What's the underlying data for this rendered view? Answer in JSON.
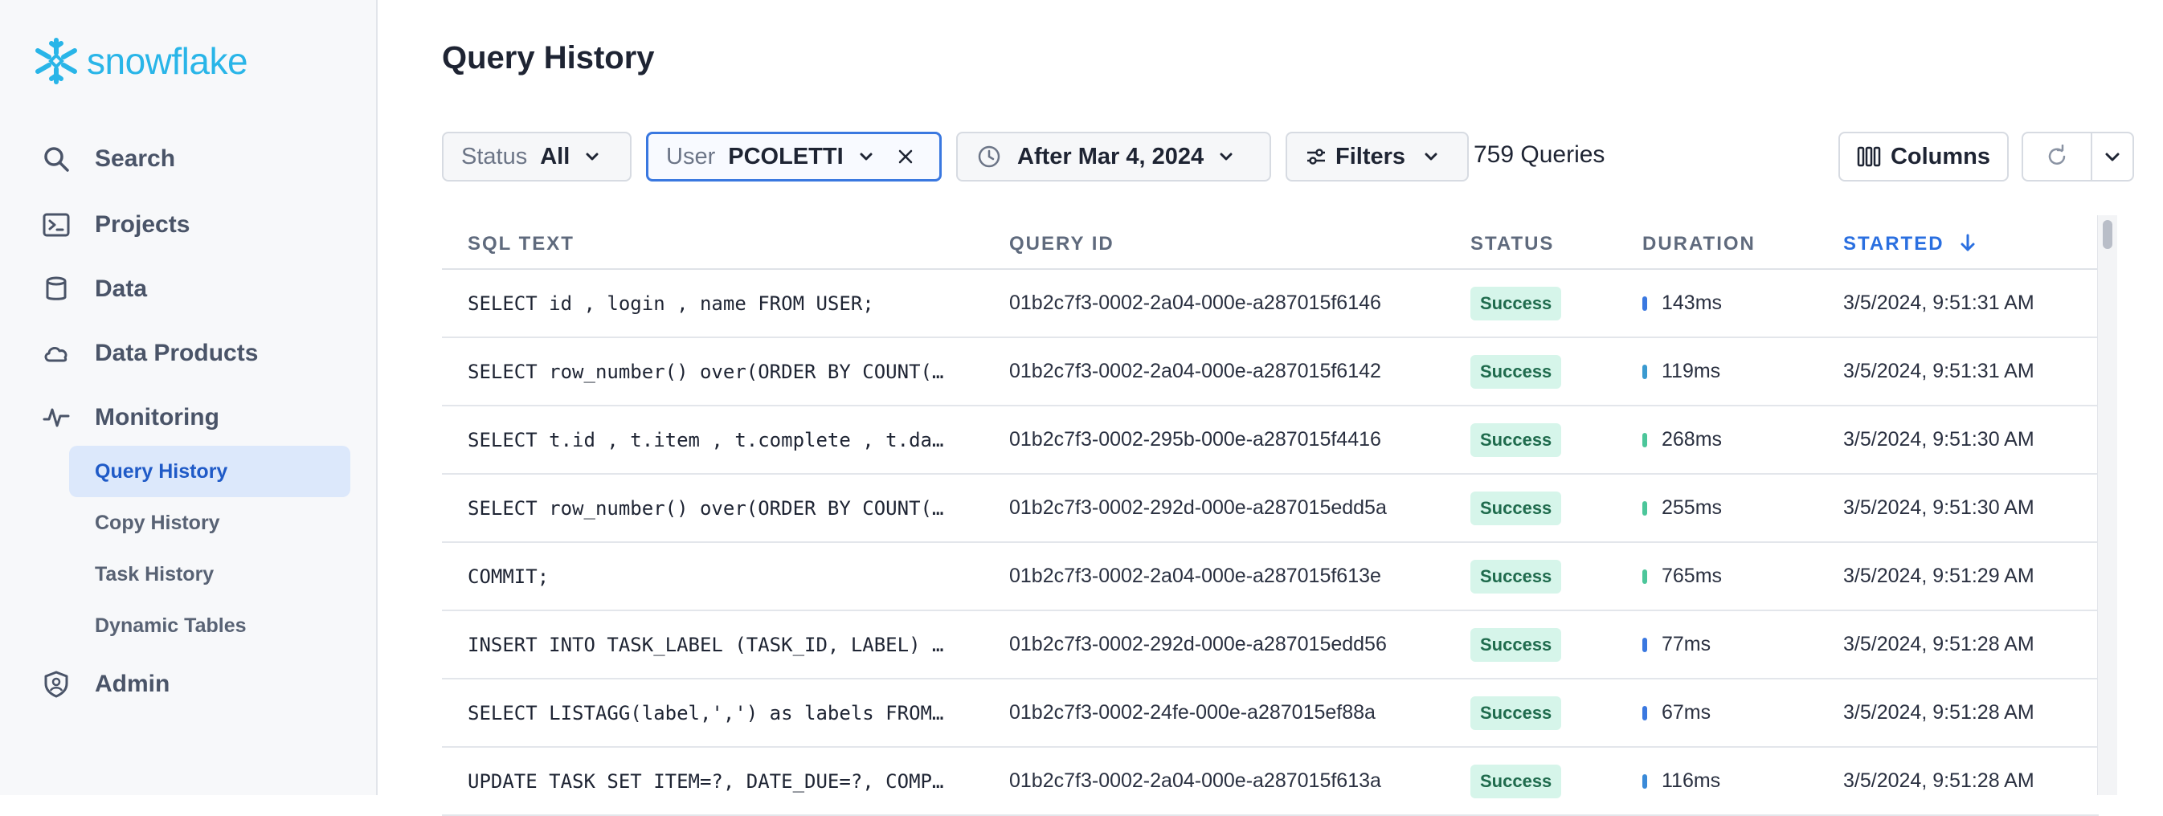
{
  "logo": {
    "text": "snowflake",
    "color": "#29b5e8"
  },
  "nav": {
    "search": "Search",
    "projects": "Projects",
    "data": "Data",
    "data_products": "Data Products",
    "monitoring": "Monitoring",
    "admin": "Admin",
    "sub": {
      "query_history": "Query History",
      "copy_history": "Copy History",
      "task_history": "Task History",
      "dynamic_tables": "Dynamic Tables"
    }
  },
  "page": {
    "title": "Query History"
  },
  "filters": {
    "status_key": "Status",
    "status_value": "All",
    "user_key": "User",
    "user_value": "PCOLETTI",
    "date_value": "After Mar 4, 2024",
    "filters_label": "Filters",
    "count": "759 Queries",
    "columns_label": "Columns"
  },
  "table": {
    "headers": {
      "sql": "SQL TEXT",
      "query_id": "QUERY ID",
      "status": "STATUS",
      "duration": "DURATION",
      "started": "STARTED"
    },
    "rows": [
      {
        "sql": "SELECT id , login , name FROM USER;",
        "query_id": "01b2c7f3-0002-2a04-000e-a287015f6146",
        "status": "Success",
        "duration": "143ms",
        "started": "3/5/2024, 9:51:31 AM"
      },
      {
        "sql": "SELECT row_number() over(ORDER BY COUNT(…",
        "query_id": "01b2c7f3-0002-2a04-000e-a287015f6142",
        "status": "Success",
        "duration": "119ms",
        "started": "3/5/2024, 9:51:31 AM"
      },
      {
        "sql": "SELECT t.id , t.item , t.complete , t.da…",
        "query_id": "01b2c7f3-0002-295b-000e-a287015f4416",
        "status": "Success",
        "duration": "268ms",
        "started": "3/5/2024, 9:51:30 AM"
      },
      {
        "sql": "SELECT row_number() over(ORDER BY COUNT(…",
        "query_id": "01b2c7f3-0002-292d-000e-a287015edd5a",
        "status": "Success",
        "duration": "255ms",
        "started": "3/5/2024, 9:51:30 AM"
      },
      {
        "sql": "COMMIT;",
        "query_id": "01b2c7f3-0002-2a04-000e-a287015f613e",
        "status": "Success",
        "duration": "765ms",
        "started": "3/5/2024, 9:51:29 AM"
      },
      {
        "sql": "INSERT INTO TASK_LABEL (TASK_ID, LABEL) …",
        "query_id": "01b2c7f3-0002-292d-000e-a287015edd56",
        "status": "Success",
        "duration": "77ms",
        "started": "3/5/2024, 9:51:28 AM"
      },
      {
        "sql": "SELECT LISTAGG(label,',') as labels FROM…",
        "query_id": "01b2c7f3-0002-24fe-000e-a287015ef88a",
        "status": "Success",
        "duration": "67ms",
        "started": "3/5/2024, 9:51:28 AM"
      },
      {
        "sql": "UPDATE TASK SET ITEM=?, DATE_DUE=?, COMP…",
        "query_id": "01b2c7f3-0002-2a04-000e-a287015f613a",
        "status": "Success",
        "duration": "116ms",
        "started": "3/5/2024, 9:51:28 AM"
      }
    ]
  },
  "colors": {
    "accent": "#2a6fe0",
    "success_bg": "#d6f5ea",
    "success_text": "#1f6b4d",
    "duration_fast": "#3a78e0",
    "duration_slow": "#4cc69a"
  }
}
